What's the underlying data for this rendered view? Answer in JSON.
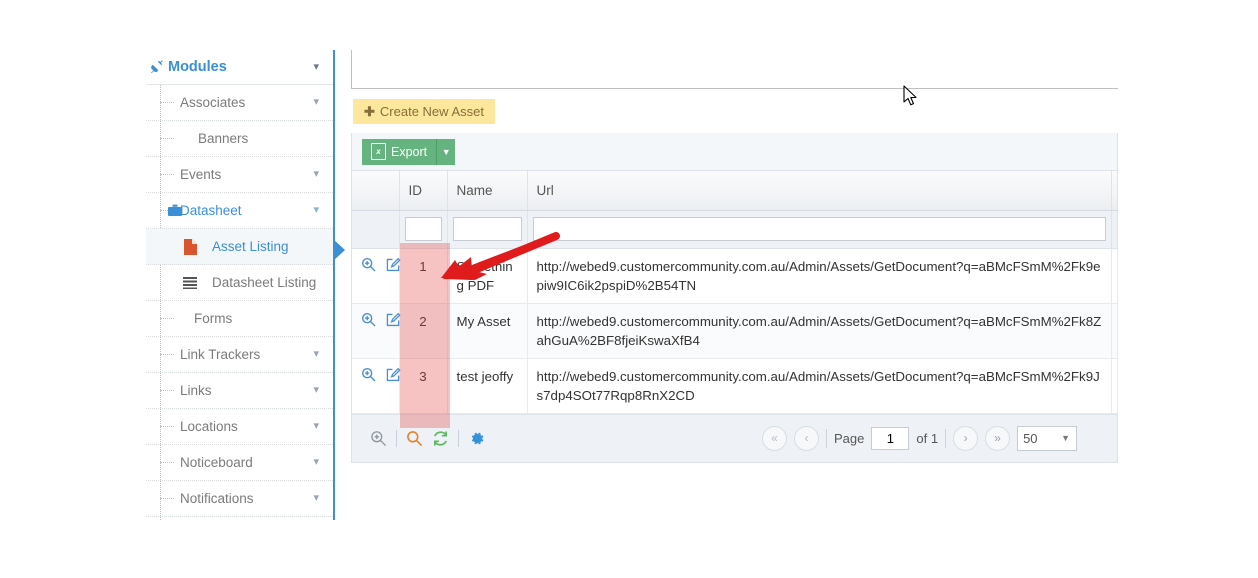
{
  "colors": {
    "accent_blue": "#3b8fd4",
    "create_btn_bg": "#fde79c",
    "create_btn_text": "#8a6d3b",
    "export_green": "#65b37e",
    "highlight_red": "#e54646",
    "arrow_red": "#e01b1b",
    "row_alt": "#fafbfc"
  },
  "sidebar": {
    "header": {
      "label": "Modules",
      "icon": "plug-icon",
      "chevron": "chevron-down-icon"
    },
    "items": [
      {
        "label": "Associates",
        "level": 1,
        "chevron": "chevron-down-icon",
        "icon": null,
        "active": false
      },
      {
        "label": "Banners",
        "level": 2,
        "chevron": null,
        "icon": null,
        "active": false
      },
      {
        "label": "Events",
        "level": 1,
        "chevron": "chevron-down-icon",
        "icon": null,
        "active": false
      },
      {
        "label": "Datasheet",
        "level": 1,
        "chevron": "chevron-down-icon",
        "icon": "briefcase-icon",
        "active": false,
        "blue": true
      },
      {
        "label": "Asset Listing",
        "level": 3,
        "chevron": null,
        "icon": "file-icon",
        "active": true
      },
      {
        "label": "Datasheet Listing",
        "level": 3,
        "chevron": null,
        "icon": "list-icon",
        "active": false
      },
      {
        "label": "Forms",
        "level": 2,
        "chevron": null,
        "icon": null,
        "active": false
      },
      {
        "label": "Link Trackers",
        "level": 1,
        "chevron": "chevron-down-icon",
        "icon": null,
        "active": false
      },
      {
        "label": "Links",
        "level": 1,
        "chevron": "chevron-down-icon",
        "icon": null,
        "active": false
      },
      {
        "label": "Locations",
        "level": 1,
        "chevron": "chevron-down-icon",
        "icon": null,
        "active": false
      },
      {
        "label": "Noticeboard",
        "level": 1,
        "chevron": "chevron-down-icon",
        "icon": null,
        "active": false
      },
      {
        "label": "Notifications",
        "level": 1,
        "chevron": "chevron-down-icon",
        "icon": null,
        "active": false
      }
    ]
  },
  "toolbar": {
    "create_label": "Create New Asset",
    "create_icon": "plus-icon",
    "export_label": "Export",
    "export_icon": "excel-icon",
    "export_caret_icon": "caret-down-icon"
  },
  "table": {
    "columns": [
      "",
      "ID",
      "Name",
      "Url"
    ],
    "filters": {
      "actions": "",
      "id": "",
      "name": "",
      "url": ""
    },
    "rows": [
      {
        "actions": [
          "search-plus-icon",
          "edit-icon"
        ],
        "id": "1",
        "name": "Something PDF",
        "url": "http://webed9.customercommunity.com.au/Admin/Assets/GetDocument?q=aBMcFSmM%2Fk9epiw9IC6ik2pspiD%2B54TN"
      },
      {
        "actions": [
          "search-plus-icon",
          "edit-icon"
        ],
        "id": "2",
        "name": "My Asset",
        "url": "http://webed9.customercommunity.com.au/Admin/Assets/GetDocument?q=aBMcFSmM%2Fk8ZahGuA%2BF8fjeiKswaXfB4"
      },
      {
        "actions": [
          "search-plus-icon",
          "edit-icon"
        ],
        "id": "3",
        "name": "test jeoffy",
        "url": "http://webed9.customercommunity.com.au/Admin/Assets/GetDocument?q=aBMcFSmM%2Fk9Js7dp4SOt77Rqp8RnX2CD"
      }
    ]
  },
  "footer": {
    "tools": [
      "zoom-in-icon",
      "search-icon",
      "refresh-icon",
      "settings-gear-icon"
    ],
    "first_icon": "double-chevron-left-icon",
    "prev_icon": "chevron-left-icon",
    "page_label": "Page",
    "page_value": "1",
    "of_label": "of 1",
    "next_icon": "chevron-right-icon",
    "last_icon": "double-chevron-right-icon",
    "page_size": "50",
    "page_size_caret": "caret-down-icon"
  },
  "annotations": {
    "highlight_column": "ID",
    "arrow_target": "row-1-id-cell"
  }
}
